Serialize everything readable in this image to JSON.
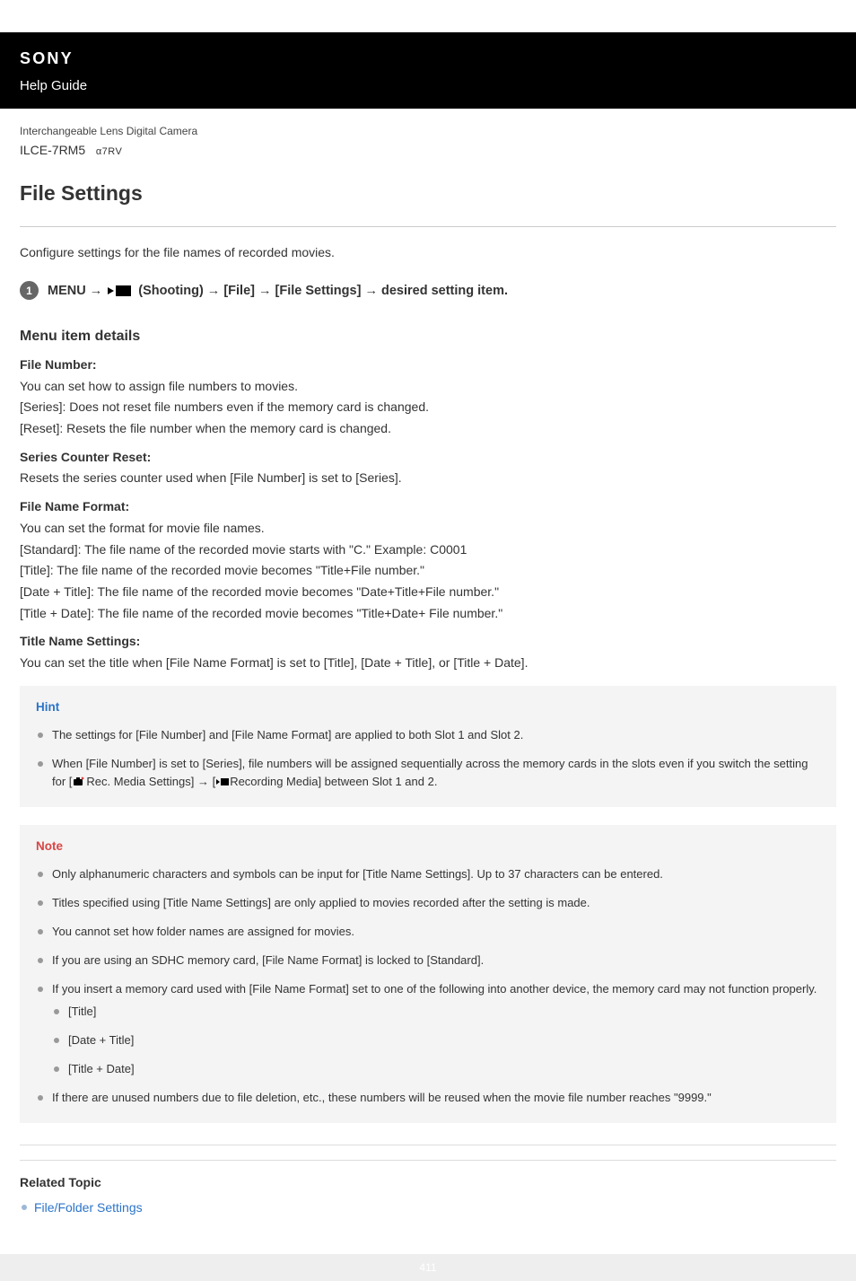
{
  "header": {
    "brand": "SONY",
    "help_guide": "Help Guide",
    "product_line": "Interchangeable Lens Digital Camera",
    "model": "ILCE-7RM5",
    "model_suffix": "α7RV"
  },
  "page": {
    "title": "File Settings",
    "intro": "Configure settings for the file names of recorded movies."
  },
  "step": {
    "number": "1",
    "menu": "MENU",
    "shooting_label": "(Shooting)",
    "path_file": "[File]",
    "path_file_settings": "[File Settings]",
    "path_desired": "desired setting item."
  },
  "menu_details": {
    "heading": "Menu item details",
    "items": [
      {
        "title": "File Number:",
        "desc": "You can set how to assign file numbers to movies.",
        "options": [
          "[Series]: Does not reset file numbers even if the memory card is changed.",
          "[Reset]: Resets the file number when the memory card is changed."
        ]
      },
      {
        "title": "Series Counter Reset:",
        "desc": "Resets the series counter used when [File Number] is set to [Series].",
        "options": []
      },
      {
        "title": "File Name Format:",
        "desc": "You can set the format for movie file names.",
        "options": [
          "[Standard]: The file name of the recorded movie starts with \"C.\" Example: C0001",
          "[Title]: The file name of the recorded movie becomes \"Title+File number.\"",
          "[Date + Title]: The file name of the recorded movie becomes \"Date+Title+File number.\"",
          "[Title + Date]: The file name of the recorded movie becomes \"Title+Date+ File number.\""
        ]
      },
      {
        "title": "Title Name Settings:",
        "desc": "You can set the title when [File Name Format] is set to [Title], [Date + Title], or [Title + Date].",
        "options": []
      }
    ]
  },
  "hint": {
    "title": "Hint",
    "items": [
      {
        "parts": [
          "The settings for [File Number] and [File Name Format] are applied to both Slot 1 and Slot 2."
        ]
      },
      {
        "parts": [
          "When [File Number] is set to [Series], file numbers will be assigned sequentially across the memory cards in the slots even if you switch the setting for [",
          "ICON_CAMERA",
          "Rec. Media Settings] → [",
          "ICON_MOVIE",
          "Recording Media] between Slot 1 and 2."
        ]
      }
    ]
  },
  "note": {
    "title": "Note",
    "items": [
      {
        "text": "Only alphanumeric characters and symbols can be input for [Title Name Settings]. Up to 37 characters can be entered."
      },
      {
        "text": "Titles specified using [Title Name Settings] are only applied to movies recorded after the setting is made."
      },
      {
        "text": "You cannot set how folder names are assigned for movies."
      },
      {
        "text": "If you are using an SDHC memory card, [File Name Format] is locked to [Standard]."
      },
      {
        "text": "If you insert a memory card used with [File Name Format] set to one of the following into another device, the memory card may not function properly.",
        "sub": [
          "[Title]",
          "[Date + Title]",
          "[Title + Date]"
        ]
      },
      {
        "text": "If there are unused numbers due to file deletion, etc., these numbers will be reused when the movie file number reaches \"9999.\""
      }
    ]
  },
  "related": {
    "title": "Related Topic",
    "links": [
      {
        "label": "File/Folder Settings"
      }
    ]
  },
  "footer": {
    "page_number": "411"
  }
}
